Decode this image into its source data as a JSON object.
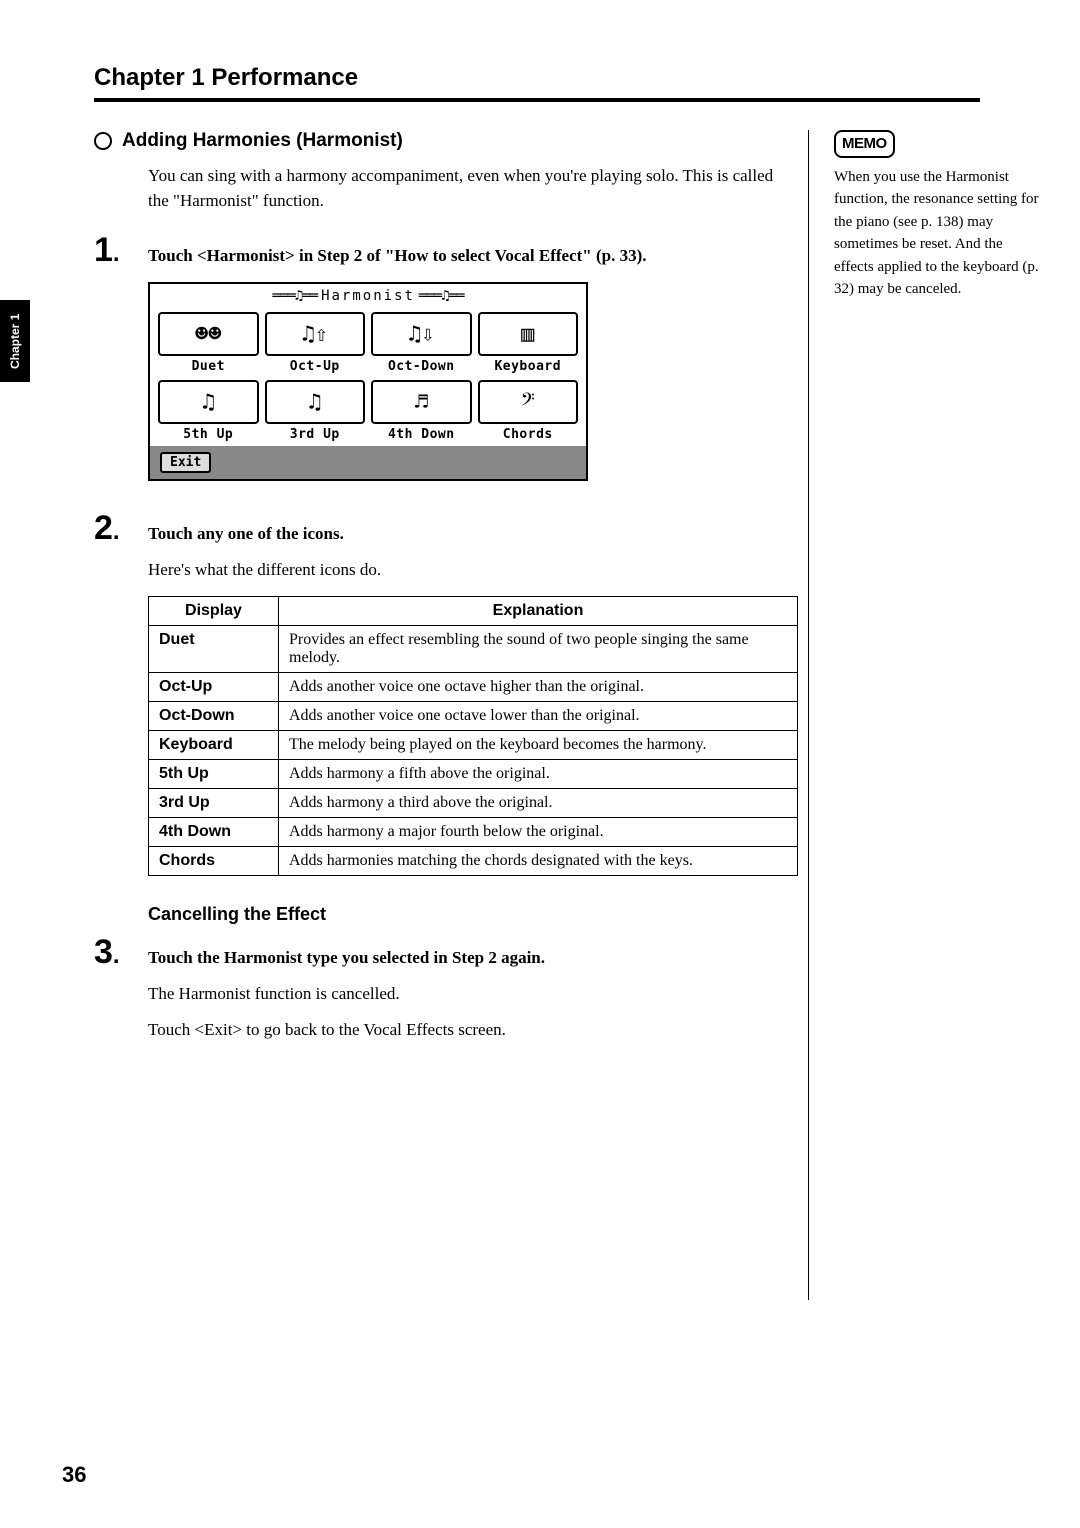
{
  "chapter_title": "Chapter 1 Performance",
  "side_tab": "Chapter 1",
  "subhead": "Adding Harmonies (Harmonist)",
  "intro1": "You can sing with a harmony accompaniment, even when you're playing solo. This is called the \"Harmonist\" function.",
  "steps": {
    "s1_num": "1",
    "s1_text": "Touch <Harmonist> in Step 2 of \"How to select Vocal Effect\" (p. 33).",
    "s2_num": "2",
    "s2_text": "Touch any one of the icons.",
    "s2_after": "Here's what the different icons do.",
    "s3_num": "3",
    "s3_text": "Touch the Harmonist type you selected in Step 2 again.",
    "s3_after1": "The Harmonist function is cancelled.",
    "s3_after2": "Touch <Exit> to go back to the Vocal Effects screen."
  },
  "screenshot": {
    "title": "Harmonist",
    "icons": [
      {
        "glyph": "☻☻",
        "label": "Duet"
      },
      {
        "glyph": "♫⇧",
        "label": "Oct-Up"
      },
      {
        "glyph": "♫⇩",
        "label": "Oct-Down"
      },
      {
        "glyph": "▥",
        "label": "Keyboard"
      },
      {
        "glyph": "♫",
        "label": "5th Up"
      },
      {
        "glyph": "♫",
        "label": "3rd Up"
      },
      {
        "glyph": "♬",
        "label": "4th Down"
      },
      {
        "glyph": "𝄢",
        "label": "Chords"
      }
    ],
    "exit": "Exit"
  },
  "table_headers": {
    "display": "Display",
    "explanation": "Explanation"
  },
  "table_rows": [
    {
      "name": "Duet",
      "text": "Provides an effect resembling the sound of two people singing the same melody."
    },
    {
      "name": "Oct-Up",
      "text": "Adds another voice one octave higher than the original."
    },
    {
      "name": "Oct-Down",
      "text": "Adds another voice one octave lower than the original."
    },
    {
      "name": "Keyboard",
      "text": "The melody being played on the keyboard becomes the harmony."
    },
    {
      "name": "5th Up",
      "text": "Adds harmony a fifth above the original."
    },
    {
      "name": "3rd Up",
      "text": "Adds harmony a third above the original."
    },
    {
      "name": "4th Down",
      "text": "Adds harmony a major fourth below the original."
    },
    {
      "name": "Chords",
      "text": "Adds harmonies matching the chords designated with the keys."
    }
  ],
  "cancel_head": "Cancelling the Effect",
  "memo": {
    "label": "MEMO",
    "text": "When you use the Harmonist function, the resonance setting for the piano (see p. 138) may sometimes be reset. And the effects applied to the keyboard (p. 32) may be canceled."
  },
  "page_num": "36"
}
